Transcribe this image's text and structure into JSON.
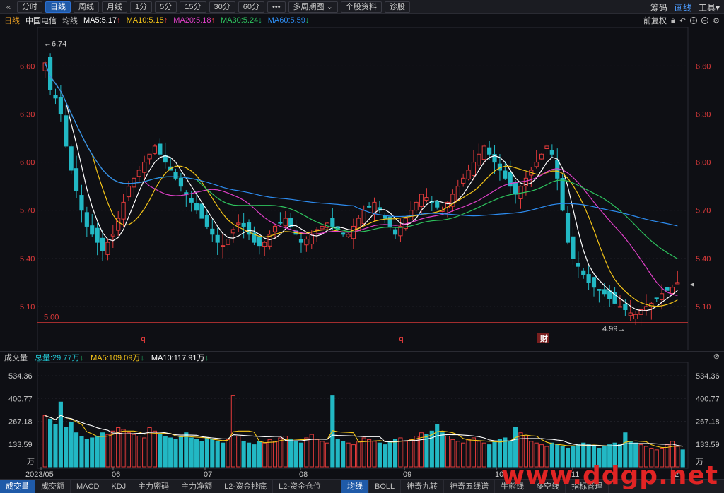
{
  "toolbar": {
    "items": [
      "分时",
      "日线",
      "周线",
      "月线",
      "1分",
      "5分",
      "15分",
      "30分",
      "60分",
      "•••",
      "多周期图",
      "个股资料",
      "诊股"
    ],
    "active_index": 1,
    "right_items": [
      "筹码",
      "画线",
      "工具"
    ]
  },
  "legend": {
    "period": "日线",
    "stock": "中国电信",
    "ma_label": "均线",
    "ma5": "MA5:5.17",
    "ma10": "MA10:5.15",
    "ma20": "MA20:5.18",
    "ma30": "MA30:5.24",
    "ma60": "MA60:5.59",
    "adjust": "前复权",
    "colors": {
      "ma5": "#ffffff",
      "ma10": "#f5c518",
      "ma20": "#e040c8",
      "ma30": "#2ec45e",
      "ma60": "#2d8cf0",
      "up": "#e23b3b",
      "down": "#22b8c4"
    }
  },
  "chart": {
    "price_ticks": [
      "6.60",
      "6.30",
      "6.00",
      "5.70",
      "5.40",
      "5.10"
    ],
    "high_label": "6.74",
    "low_label": "4.99",
    "base_label": "5.00",
    "markers": [
      "q",
      "q",
      "财"
    ],
    "x_labels": [
      "2023/05",
      "06",
      "07",
      "08",
      "09",
      "10",
      "11",
      "12"
    ]
  },
  "volume": {
    "title": "成交量",
    "total": "总量:29.77万",
    "ma5": "MA5:109.09万",
    "ma10": "MA10:117.91万",
    "ticks": [
      "534.36",
      "400.77",
      "267.18",
      "133.59"
    ],
    "unit": "万"
  },
  "bottom_tabs": [
    "成交量",
    "成交额",
    "MACD",
    "KDJ",
    "主力密码",
    "主力净额",
    "L2-资金抄底",
    "L2-资金仓位",
    "均线",
    "BOLL",
    "神奇九转",
    "神奇五线谱",
    "牛熊线",
    "多空线",
    "指标管理"
  ],
  "bottom_active": [
    0,
    8
  ],
  "watermark": "www.ddgp.net",
  "chart_data": {
    "type": "candlestick",
    "y_range": [
      4.95,
      6.8
    ],
    "volume_range": [
      0,
      580
    ],
    "closes": [
      6.62,
      6.45,
      6.4,
      6.3,
      6.1,
      5.95,
      5.82,
      5.7,
      5.6,
      5.55,
      5.5,
      5.45,
      5.5,
      5.55,
      5.65,
      5.75,
      5.85,
      5.9,
      5.95,
      6.0,
      6.05,
      6.1,
      6.05,
      6.0,
      5.95,
      5.9,
      5.85,
      5.8,
      5.75,
      5.7,
      5.65,
      5.6,
      5.55,
      5.5,
      5.48,
      5.52,
      5.58,
      5.62,
      5.6,
      5.55,
      5.5,
      5.48,
      5.5,
      5.55,
      5.6,
      5.62,
      5.65,
      5.6,
      5.55,
      5.5,
      5.52,
      5.55,
      5.58,
      5.6,
      5.62,
      5.6,
      5.58,
      5.55,
      5.55,
      5.6,
      5.65,
      5.7,
      5.72,
      5.75,
      5.7,
      5.65,
      5.6,
      5.55,
      5.6,
      5.65,
      5.7,
      5.75,
      5.8,
      5.78,
      5.75,
      5.72,
      5.7,
      5.75,
      5.8,
      5.85,
      5.9,
      5.95,
      6.0,
      6.05,
      6.1,
      6.05,
      6.0,
      5.95,
      5.9,
      5.85,
      5.8,
      5.85,
      5.9,
      5.95,
      6.0,
      6.05,
      6.1,
      6.05,
      5.9,
      5.7,
      5.5,
      5.4,
      5.35,
      5.3,
      5.25,
      5.22,
      5.2,
      5.18,
      5.15,
      5.12,
      5.1,
      5.08,
      5.06,
      5.05,
      5.08,
      5.1,
      5.12,
      5.15,
      5.18,
      5.2,
      5.22,
      5.25
    ],
    "volumes": [
      300,
      280,
      250,
      380,
      230,
      260,
      200,
      180,
      160,
      170,
      180,
      200,
      190,
      210,
      230,
      220,
      200,
      190,
      180,
      170,
      230,
      210,
      190,
      180,
      170,
      160,
      180,
      200,
      170,
      160,
      150,
      170,
      160,
      150,
      140,
      160,
      420,
      180,
      150,
      140,
      130,
      150,
      140,
      160,
      150,
      170,
      180,
      160,
      150,
      140,
      170,
      190,
      160,
      150,
      140,
      420,
      160,
      150,
      140,
      130,
      150,
      170,
      160,
      150,
      140,
      130,
      150,
      160,
      170,
      150,
      160,
      180,
      200,
      190,
      210,
      250,
      200,
      180,
      160,
      150,
      140,
      160,
      170,
      150,
      140,
      130,
      150,
      160,
      170,
      150,
      230,
      200,
      180,
      150,
      140,
      130,
      120,
      140,
      130,
      120,
      110,
      120,
      130,
      140,
      130,
      120,
      110,
      120,
      130,
      140,
      130,
      200,
      150,
      140,
      130,
      120,
      110,
      100,
      110,
      130,
      150,
      120,
      100
    ]
  }
}
